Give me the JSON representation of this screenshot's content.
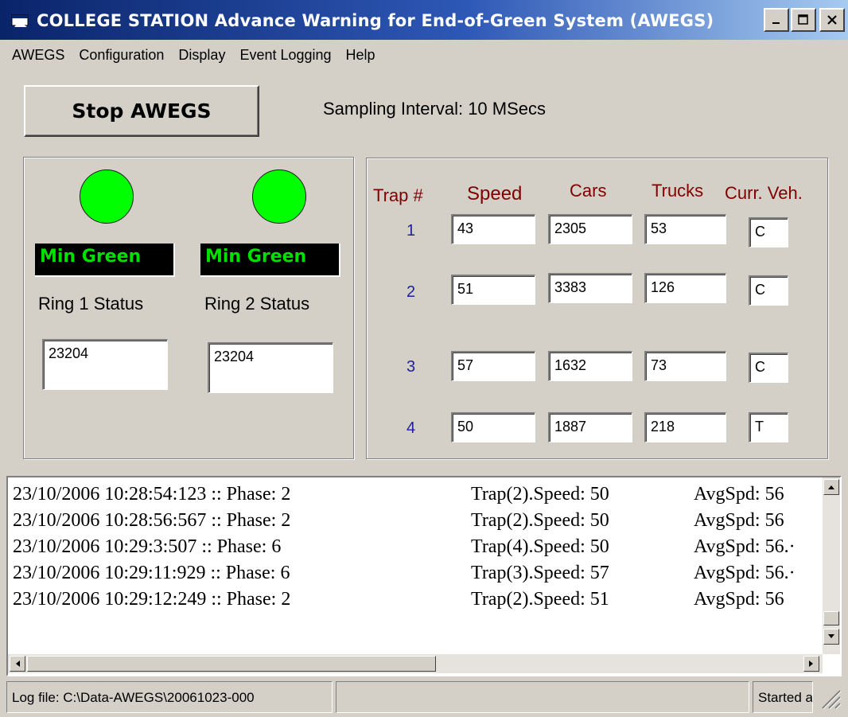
{
  "window": {
    "title": "COLLEGE STATION  Advance Warning for End-of-Green System (AWEGS)",
    "controls": [
      "minimize-icon",
      "maximize-icon",
      "close-icon"
    ]
  },
  "menu": [
    "AWEGS",
    "Configuration",
    "Display",
    "Event Logging",
    "Help"
  ],
  "toolbar": {
    "stop_label": "Stop AWEGS",
    "sampling_text": "Sampling Interval: 10 MSecs"
  },
  "rings": [
    {
      "status": "Min Green",
      "label": "Ring 1 Status",
      "value": "23204",
      "led_color": "#00ff00"
    },
    {
      "status": "Min Green",
      "label": "Ring 2 Status",
      "value": "23204",
      "led_color": "#00ff00"
    }
  ],
  "traps": {
    "headers": [
      "Trap #",
      "Speed",
      "Cars",
      "Trucks",
      "Curr. Veh."
    ],
    "rows": [
      {
        "num": "1",
        "speed": "43",
        "cars": "2305",
        "trucks": "53",
        "veh": "C"
      },
      {
        "num": "2",
        "speed": "51",
        "cars": "3383",
        "trucks": "126",
        "veh": "C"
      },
      {
        "num": "3",
        "speed": "57",
        "cars": "1632",
        "trucks": "73",
        "veh": "C"
      },
      {
        "num": "4",
        "speed": "50",
        "cars": "1887",
        "trucks": "218",
        "veh": "T"
      }
    ]
  },
  "log": [
    {
      "time": "23/10/2006  10:28:54:123 :: Phase: 2",
      "trap": "Trap(2).Speed: 50",
      "avg": "AvgSpd: 56"
    },
    {
      "time": "23/10/2006  10:28:56:567 :: Phase: 2",
      "trap": "Trap(2).Speed: 50",
      "avg": "AvgSpd: 56"
    },
    {
      "time": "23/10/2006  10:29:3:507 :: Phase: 6",
      "trap": "Trap(4).Speed: 50",
      "avg": "AvgSpd: 56.·"
    },
    {
      "time": "23/10/2006  10:29:11:929 :: Phase: 6",
      "trap": "Trap(3).Speed: 57",
      "avg": "AvgSpd: 56.·"
    },
    {
      "time": "23/10/2006  10:29:12:249 :: Phase: 2",
      "trap": "Trap(2).Speed: 51",
      "avg": "AvgSpd: 56"
    }
  ],
  "statusbar": {
    "log_file": "Log file: C:\\Data-AWEGS\\20061023-000",
    "middle": "",
    "started": "Started a"
  },
  "colors": {
    "accent_title": "#0a246a",
    "header_text": "#800000",
    "trap_number": "#2020a0",
    "status_green": "#00e000"
  }
}
